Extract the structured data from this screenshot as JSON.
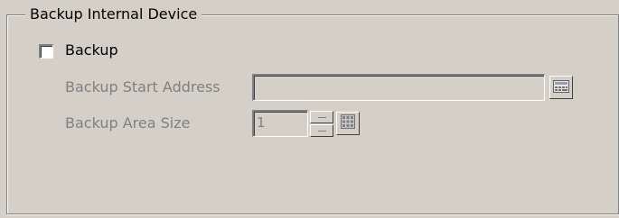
{
  "group": {
    "title": "Backup Internal Device"
  },
  "backup": {
    "label": "Backup",
    "checked": false
  },
  "fields": {
    "start_address_label": "Backup Start Address",
    "start_address_value": "",
    "area_size_label": "Backup Area Size",
    "area_size_value": "1"
  },
  "icons": {
    "address_picker": "address-input-icon",
    "keypad": "keypad-icon",
    "spin_up": "spin-up-arrow-icon",
    "spin_down": "spin-down-arrow-icon"
  },
  "colors": {
    "background": "#d4d0c8",
    "disabled_text": "#808080"
  }
}
